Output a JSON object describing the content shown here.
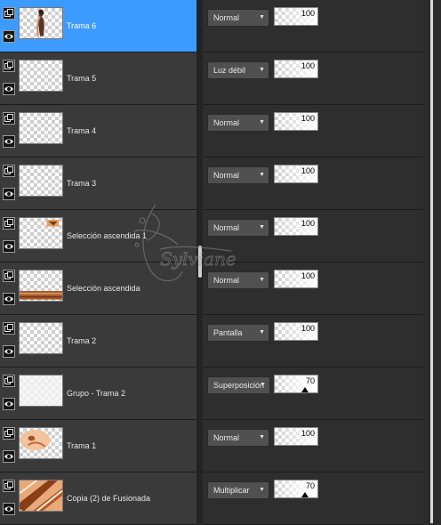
{
  "layers": [
    {
      "name": "Trama 6",
      "blend": "Normal",
      "opacity": 100,
      "selected": true,
      "thumb": "woman-figure"
    },
    {
      "name": "Trama 5",
      "blend": "Luz débil",
      "opacity": 100,
      "selected": false,
      "thumb": "blank"
    },
    {
      "name": "Trama 4",
      "blend": "Normal",
      "opacity": 100,
      "selected": false,
      "thumb": "blank"
    },
    {
      "name": "Trama 3",
      "blend": "Normal",
      "opacity": 100,
      "selected": false,
      "thumb": "blank"
    },
    {
      "name": "Selección ascendida 1",
      "blend": "Normal",
      "opacity": 100,
      "selected": false,
      "thumb": "small-orange-corner"
    },
    {
      "name": "Selección ascendida",
      "blend": "Normal",
      "opacity": 100,
      "selected": false,
      "thumb": "orange-bottom-strip"
    },
    {
      "name": "Trama 2",
      "blend": "Pantalla",
      "opacity": 100,
      "selected": false,
      "thumb": "blank"
    },
    {
      "name": "Grupo - Trama 2",
      "blend": "Superposición",
      "opacity": 70,
      "selected": false,
      "thumb": "faint"
    },
    {
      "name": "Trama 1",
      "blend": "Normal",
      "opacity": 100,
      "selected": false,
      "thumb": "orange-blob"
    },
    {
      "name": "Copia (2) de Fusionada",
      "blend": "Multiplicar",
      "opacity": 70,
      "selected": false,
      "thumb": "orange-diagonal"
    }
  ],
  "watermark": {
    "text": "Sylviane"
  },
  "colors": {
    "selected": "#3c9bff",
    "panel": "#3a3a3a",
    "dropdown": "#505050"
  },
  "icons": {
    "layer_icon": "layers-icon",
    "visibility_icon": "eye-icon",
    "dropdown_icon": "chevron-down-icon"
  }
}
